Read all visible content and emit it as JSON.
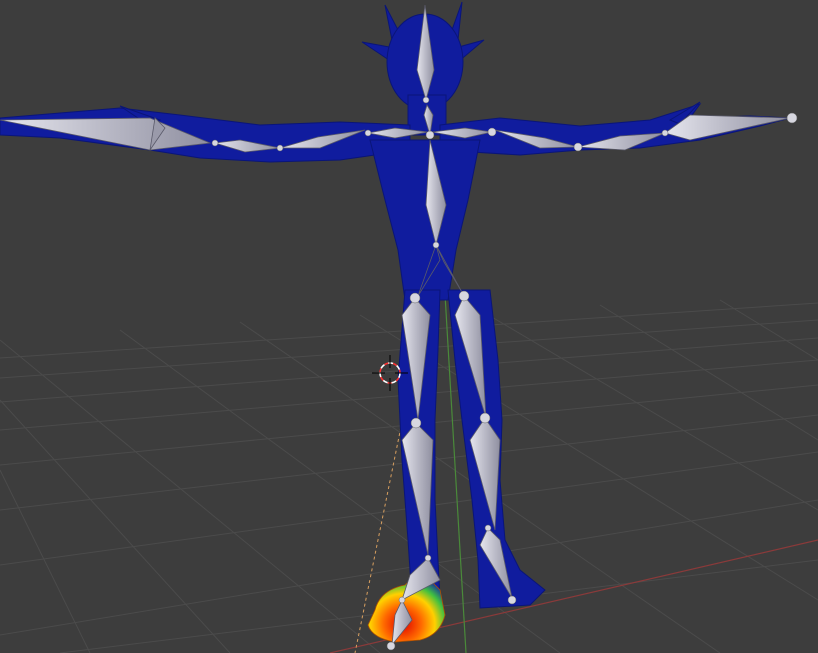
{
  "viewport": {
    "background": "#3d3d3d",
    "grid_color": "#4a4a4a",
    "axis_x_color": "#8a3a3a",
    "axis_y_color": "#4a8a3a",
    "mesh_color": "#101c9e",
    "bone_color": "#c8c8d2",
    "weight_paint": "heat-gradient",
    "cursor_icon": "3d-cursor-icon"
  }
}
